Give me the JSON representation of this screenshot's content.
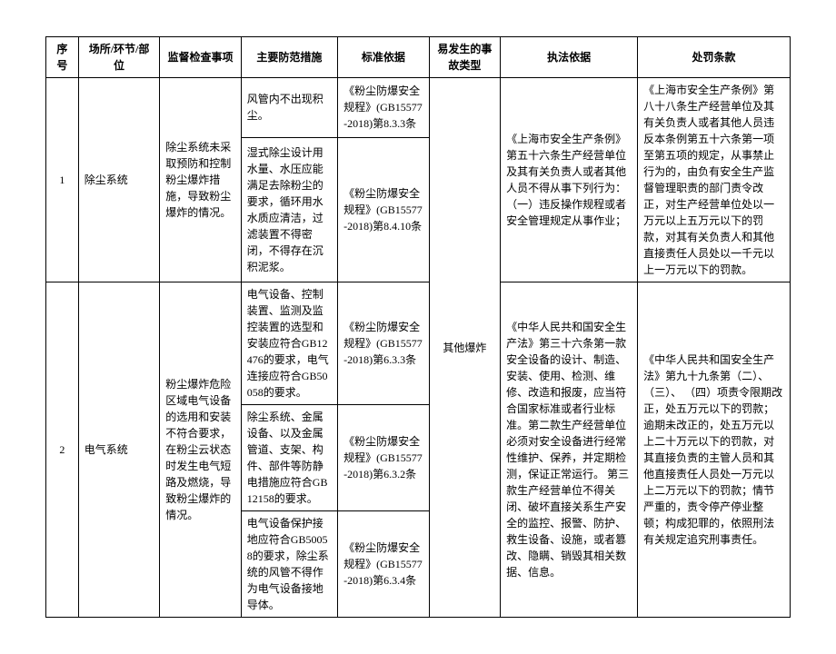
{
  "headers": {
    "idx": "序号",
    "loc": "场所/环节/部位",
    "item": "监督检查事项",
    "meas": "主要防范措施",
    "std": "标准依据",
    "acc": "易发生的事故类型",
    "legal": "执法依据",
    "pen": "处罚条款"
  },
  "rows": {
    "r1": {
      "idx": "1",
      "loc": "除尘系统",
      "item": "除尘系统未采取预防和控制粉尘爆炸措施，导致粉尘爆炸的情况。",
      "meas1": "风管内不出现积尘。",
      "std1": "《粉尘防爆安全规程》(GB15577-2018)第8.3.3条",
      "meas2": "湿式除尘设计用水量、水压应能满足去除粉尘的要求，循环用水水质应清洁，过滤装置不得密闭，不得存在沉积泥浆。",
      "std2": "《粉尘防爆安全规程》(GB15577-2018)第8.4.10条",
      "legal": "《上海市安全生产条例》第五十六条生产经营单位及其有关负责人或者其他人员不得从事下列行为：（一）违反操作规程或者安全管理规定从事作业；",
      "pen": "《上海市安全生产条例》第八十八条生产经营单位及其有关负责人或者其他人员违反本条例第五十六条第一项至第五项的规定，从事禁止行为的，由负有安全生产监督管理职责的部门责令改正，对生产经营单位处以一万元以上五万元以下的罚款，对其有关负责人和其他直接责任人员处以一千元以上一万元以下的罚款。"
    },
    "r2": {
      "idx": "2",
      "loc": "电气系统",
      "item": "粉尘爆炸危险区域电气设备的选用和安装不符合要求，在粉尘云状态时发生电气短路及燃烧，导致粉尘爆炸的情况。",
      "meas1": "电气设备、控制装置、监测及监控装置的选型和安装应符合GB12476的要求，电气连接应符合GB50058的要求。",
      "std1": "《粉尘防爆安全规程》(GB15577-2018)第6.3.3条",
      "meas2": "除尘系统、金属设备、以及金属管道、支架、构件、部件等防静电措施应符合GB12158的要求。",
      "std2": "《粉尘防爆安全规程》(GB15577-2018)第6.3.2条",
      "meas3": "电气设备保护接地应符合GB50058的要求，除尘系统的风管不得作为电气设备接地导体。",
      "std3": "《粉尘防爆安全规程》(GB15577-2018)第6.3.4条",
      "legal": "《中华人民共和国安全生产法》第三十六条第一款安全设备的设计、制造、安装、使用、检测、维修、改造和报废，应当符合国家标准或者行业标准。第二款生产经营单位必须对安全设备进行经常性维护、保养，并定期检测，保证正常运行。\n第三款生产经营单位不得关闭、破坏直接关系生产安全的监控、报警、防护、救生设备、设施，或者篡改、隐瞒、销毁其相关数据、信息。",
      "pen": "《中华人民共和国安全生产法》第九十九条第（二）、（三）、\n（四）项责令限期改正，处五万元以下的罚款；逾期未改正的，处五万元以上二十万元以下的罚款，对其直接负责的主管人员和其他直接责任人员处一万元以上二万元以下的罚款；情节严重的，责令停产停业整顿；构成犯罪的，依照刑法有关规定追究刑事责任。"
    },
    "acc": "其他爆炸"
  }
}
